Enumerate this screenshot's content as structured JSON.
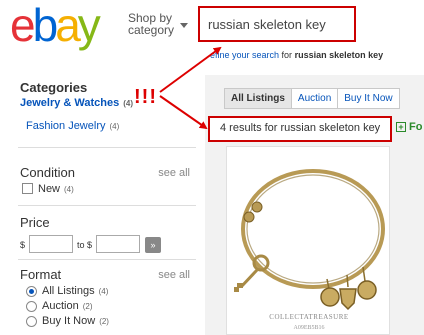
{
  "header": {
    "logo_letters": [
      "e",
      "b",
      "a",
      "y"
    ],
    "logo_colors": [
      "#e53238",
      "#0064d2",
      "#f5af02",
      "#86b817"
    ],
    "shop_by_line1": "Shop by",
    "shop_by_line2": "category",
    "search_value": "russian skeleton key",
    "refine_link": "efine your search",
    "refine_rest": " for ",
    "refine_query": "russian skeleton key"
  },
  "sidebar": {
    "categories_title": "Categories",
    "category_items": [
      {
        "label": "Jewelry & Watches",
        "count": "(4)"
      },
      {
        "label": "Fashion Jewelry",
        "count": "(4)"
      }
    ],
    "condition_title": "Condition",
    "condition_see_all": "see all",
    "condition_options": [
      {
        "label": "New",
        "count": "(4)"
      }
    ],
    "price_title": "Price",
    "price_from_symbol": "$",
    "price_to_label": "to $",
    "price_go_icon": "double-chevron-right-icon",
    "format_title": "Format",
    "format_see_all": "see all",
    "format_options": [
      {
        "label": "All Listings",
        "count": "(4)",
        "checked": true
      },
      {
        "label": "Auction",
        "count": "(2)",
        "checked": false
      },
      {
        "label": "Buy It Now",
        "count": "(2)",
        "checked": false
      }
    ]
  },
  "annotation": {
    "exclamation": "!!!",
    "color": "#dd0000"
  },
  "results": {
    "tabs": [
      {
        "label": "All Listings",
        "active": true
      },
      {
        "label": "Auction",
        "active": false
      },
      {
        "label": "Buy It Now",
        "active": false
      }
    ],
    "results_text": "4 results for russian skeleton key",
    "follow_label": "Fo",
    "product_watermark_line1": "COLLECTATREASURE",
    "product_watermark_line2": "A09EB5B16"
  },
  "colors": {
    "link": "#0654ba",
    "highlight_border": "#cc0000",
    "panel_bg": "#f2f2f2",
    "bangle_gold": "#b89a55"
  }
}
